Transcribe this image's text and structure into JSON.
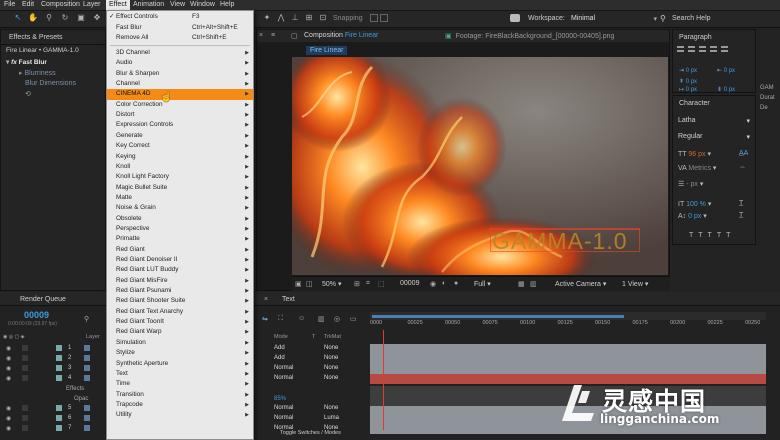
{
  "menubar": {
    "items": [
      "File",
      "Edit",
      "Composition",
      "Layer",
      "Effect",
      "Animation",
      "View",
      "Window",
      "Help"
    ]
  },
  "toolbar": {
    "snapping": "Snapping",
    "workspace_label": "Workspace:",
    "workspace_value": "Minimal",
    "search_help": "Search Help"
  },
  "effects_panel": {
    "tab": "Effects & Presets",
    "breadcrumb": "Fire Linear • GAMMA-1.0",
    "effect_name": "Fast Blur",
    "props": [
      "Blurriness",
      "Blur Dimensions"
    ]
  },
  "effect_menu": {
    "items": [
      {
        "label": "Effect Controls",
        "shortcut": "F3",
        "checked": true,
        "submenu": false
      },
      {
        "label": "Fast Blur",
        "shortcut": "Ctrl+Alt+Shift+E",
        "submenu": false
      },
      {
        "label": "Remove All",
        "shortcut": "Ctrl+Shift+E",
        "submenu": false
      },
      {
        "label": "3D Channel",
        "submenu": true
      },
      {
        "label": "Audio",
        "submenu": true
      },
      {
        "label": "Blur & Sharpen",
        "submenu": true
      },
      {
        "label": "Channel",
        "submenu": true
      },
      {
        "label": "CINEMA 4D",
        "submenu": true,
        "highlighted": true
      },
      {
        "label": "Color Correction",
        "submenu": true
      },
      {
        "label": "Distort",
        "submenu": true
      },
      {
        "label": "Expression Controls",
        "submenu": true
      },
      {
        "label": "Generate",
        "submenu": true
      },
      {
        "label": "Key Correct",
        "submenu": true
      },
      {
        "label": "Keying",
        "submenu": true
      },
      {
        "label": "Knoll",
        "submenu": true
      },
      {
        "label": "Knoll Light Factory",
        "submenu": true
      },
      {
        "label": "Magic Bullet Suite",
        "submenu": true
      },
      {
        "label": "Matte",
        "submenu": true
      },
      {
        "label": "Noise & Grain",
        "submenu": true
      },
      {
        "label": "Obsolete",
        "submenu": true
      },
      {
        "label": "Perspective",
        "submenu": true
      },
      {
        "label": "Primatte",
        "submenu": true
      },
      {
        "label": "Red Giant",
        "submenu": true
      },
      {
        "label": "Red Giant Denoiser II",
        "submenu": true
      },
      {
        "label": "Red Giant LUT Buddy",
        "submenu": true
      },
      {
        "label": "Red Giant MisFire",
        "submenu": true
      },
      {
        "label": "Red Giant Psunami",
        "submenu": true
      },
      {
        "label": "Red Giant Shooter Suite",
        "submenu": true
      },
      {
        "label": "Red Giant Text Anarchy",
        "submenu": true
      },
      {
        "label": "Red Giant ToonIt",
        "submenu": true
      },
      {
        "label": "Red Giant Warp",
        "submenu": true
      },
      {
        "label": "Simulation",
        "submenu": true
      },
      {
        "label": "Stylize",
        "submenu": true
      },
      {
        "label": "Synthetic Aperture",
        "submenu": true
      },
      {
        "label": "Text",
        "submenu": true
      },
      {
        "label": "Time",
        "submenu": true
      },
      {
        "label": "Transition",
        "submenu": true
      },
      {
        "label": "Trapcode",
        "submenu": true
      },
      {
        "label": "Utility",
        "submenu": true
      }
    ]
  },
  "composition": {
    "tab_prefix": "Composition",
    "tab_name": "Fire Linear",
    "footage_tab": "Footage: FireBlackBackground_[00000-00405].png",
    "comp_label": "Fire Linear",
    "overlay_text": "GAMMA-1.0"
  },
  "viewer_bar": {
    "zoom": "50%",
    "timecode": "00009",
    "resolution": "Full",
    "camera": "Active Camera",
    "views": "1 View"
  },
  "paragraph": {
    "title": "Paragraph",
    "values": [
      "0 px",
      "0 px",
      "0 px",
      "0 px",
      "0 px"
    ]
  },
  "character": {
    "title": "Character",
    "font": "Latha",
    "style": "Regular",
    "size": "96 px",
    "kerning": "Metrics",
    "leading": "- px",
    "scale": "100 %",
    "baseline": "0 px",
    "tsume": "0 %"
  },
  "right_edge": {
    "label1": "GAM",
    "label2": "Durat",
    "label3": "De"
  },
  "timeline": {
    "tab1": "Render Queue",
    "tab2": "Text",
    "current_time": "00009",
    "fps": "0:00:00:09 (29.97 fps)",
    "col_layer": "Layer",
    "col_mode": "Mode",
    "col_t": "T",
    "col_trkmat": "TrkMat",
    "ruler": [
      "0000",
      "00025",
      "00050",
      "00075",
      "00100",
      "00125",
      "00150",
      "00175",
      "00200",
      "00225",
      "00250"
    ],
    "layers": [
      {
        "num": "1",
        "mode": "Add",
        "trkmat": "None"
      },
      {
        "num": "2",
        "mode": "Add",
        "trkmat": "None"
      },
      {
        "num": "3",
        "mode": "Normal",
        "trkmat": "None"
      },
      {
        "num": "4",
        "mode": "Normal",
        "trkmat": "None"
      }
    ],
    "effects_label": "Effects",
    "opacity_label": "Opac",
    "opacity_value": "85%",
    "lower_layers": [
      {
        "num": "5",
        "mode": "Normal",
        "trkmat": "None"
      },
      {
        "num": "6",
        "mode": "Normal",
        "trkmat": "Luma"
      },
      {
        "num": "7",
        "mode": "Normal",
        "trkmat": "None"
      }
    ],
    "toggle": "Toggle Switches / Modes"
  },
  "watermark": {
    "cn": "灵感中国",
    "url": "lingganchina.com"
  },
  "colors": {
    "accent": "#f58b16",
    "blue": "#3d9bdc",
    "menu_bg": "#e9e9e9"
  }
}
